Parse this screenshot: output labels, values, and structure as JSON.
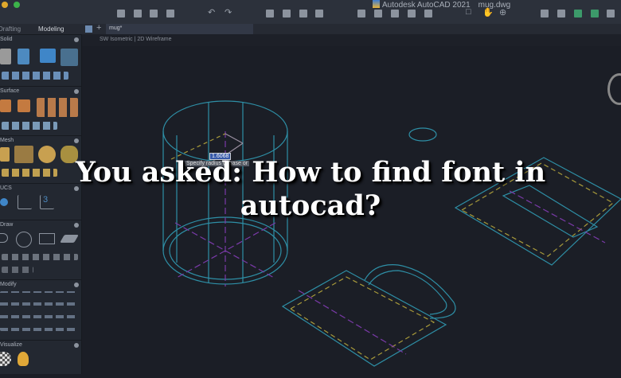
{
  "window": {
    "app_title": "Autodesk AutoCAD 2021",
    "file_name": "mug.dwg"
  },
  "workspace_tabs": [
    "Drafting",
    "Modeling"
  ],
  "document_tab": "mug*",
  "viewport": {
    "view": "SW Isometric",
    "style": "2D Wireframe"
  },
  "panels": [
    "Solid",
    "Surface",
    "Mesh",
    "UCS",
    "Draw",
    "Modify",
    "Visualize"
  ],
  "canvas": {
    "dimension_value": "1.6068",
    "prompt": "Specify radius of base or"
  },
  "headline": "You asked: How to find font in autocad?",
  "colors": {
    "cyan": "#2e8fa6",
    "yellow": "#a89a3a",
    "purple": "#7a3aa8"
  }
}
